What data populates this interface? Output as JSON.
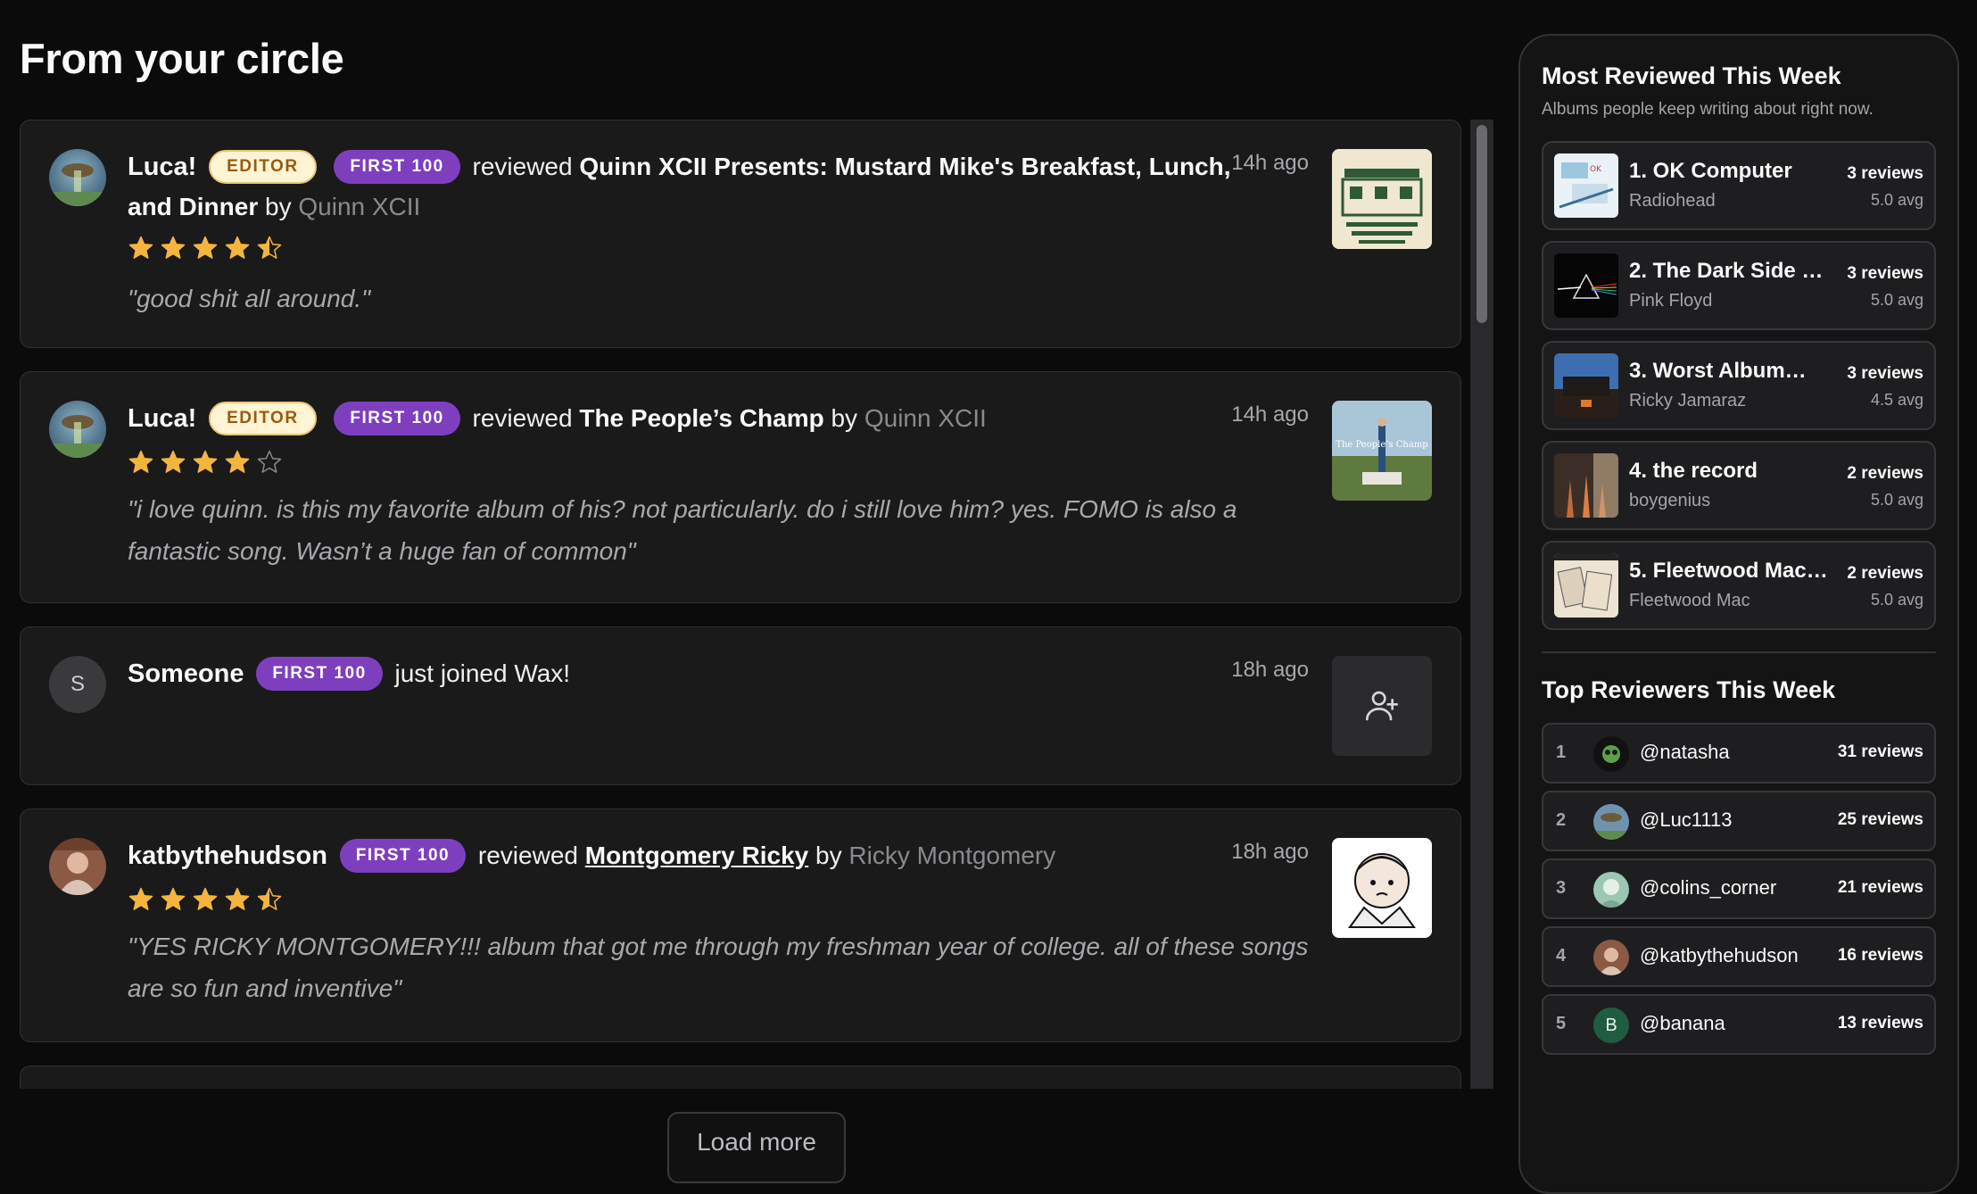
{
  "page": {
    "title": "From your circle"
  },
  "feed": {
    "items": [
      {
        "user": "Luca!",
        "badges": [
          "EDITOR",
          "FIRST 100"
        ],
        "action": "reviewed",
        "album": "Quinn XCII Presents: Mustard Mike's Breakfast, Lunch, and Dinner",
        "by": "by",
        "artist": "Quinn XCII",
        "time": "14h ago",
        "rating": 4.5,
        "quote": "\"good shit all around.\""
      },
      {
        "user": "Luca!",
        "badges": [
          "EDITOR",
          "FIRST 100"
        ],
        "action": "reviewed",
        "album": "The People’s Champ",
        "by": "by",
        "artist": "Quinn XCII",
        "time": "14h ago",
        "rating": 4,
        "quote": "\"i love quinn. is this my favorite album of his? not particularly. do i still love him? yes. FOMO is also a fantastic song. Wasn’t a huge fan of common\""
      },
      {
        "user": "Someone",
        "avatar_letter": "S",
        "badges": [
          "FIRST 100"
        ],
        "action": "just joined Wax!",
        "time": "18h ago",
        "icon": "add-user-icon"
      },
      {
        "user": "katbythehudson",
        "badges": [
          "FIRST 100"
        ],
        "action": "reviewed",
        "album": "Montgomery Ricky",
        "by": "by",
        "artist": "Ricky Montgomery",
        "time": "18h ago",
        "rating": 4.5,
        "quote": "\"YES RICKY MONTGOMERY!!! album that got me through my freshman year of college. all of these songs are so fun and inventive\""
      }
    ],
    "load_more": "Load more"
  },
  "sidebar": {
    "most_reviewed": {
      "title": "Most Reviewed This Week",
      "subtitle": "Albums people keep writing about right now.",
      "items": [
        {
          "name": "1. OK Computer",
          "artist": "Radiohead",
          "count": "3 reviews",
          "avg": "5.0 avg"
        },
        {
          "name": "2. The Dark Side …",
          "artist": "Pink Floyd",
          "count": "3 reviews",
          "avg": "5.0 avg"
        },
        {
          "name": "3. Worst Album…",
          "artist": "Ricky Jamaraz",
          "count": "3 reviews",
          "avg": "4.5 avg"
        },
        {
          "name": "4. the record",
          "artist": "boygenius",
          "count": "2 reviews",
          "avg": "5.0 avg"
        },
        {
          "name": "5. Fleetwood Mac …",
          "artist": "Fleetwood Mac",
          "count": "2 reviews",
          "avg": "5.0 avg"
        }
      ]
    },
    "top_reviewers": {
      "title": "Top Reviewers This Week",
      "items": [
        {
          "rank": "1",
          "handle": "@natasha",
          "count": "31 reviews"
        },
        {
          "rank": "2",
          "handle": "@Luc1113",
          "count": "25 reviews"
        },
        {
          "rank": "3",
          "handle": "@colins_corner",
          "count": "21 reviews"
        },
        {
          "rank": "4",
          "handle": "@katbythehudson",
          "count": "16 reviews"
        },
        {
          "rank": "5",
          "handle": "@banana",
          "avatar_letter": "B",
          "count": "13 reviews"
        }
      ]
    }
  },
  "colors": {
    "star": "#f4b53f",
    "badge_first": "#7e3fbf",
    "badge_editor": "#fff4d3"
  }
}
